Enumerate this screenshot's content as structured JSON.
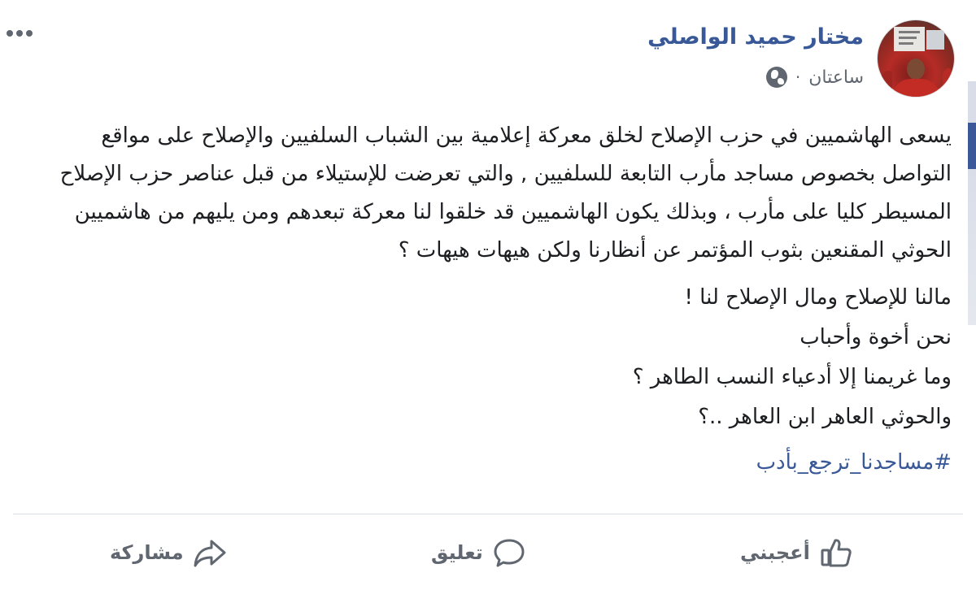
{
  "post": {
    "author": "مختار حميد الواصلي",
    "timestamp": "ساعتان",
    "separator": "·",
    "privacy_icon": "globe-icon",
    "menu_icon": "more-options-icon",
    "paragraph_1": "يسعى الهاشميين في حزب الإصلاح لخلق معركة إعلامية بين الشباب السلفيين والإصلاح على مواقع التواصل بخصوص مساجد مأرب التابعة للسلفيين , والتي تعرضت للإستيلاء من قبل عناصر حزب الإصلاح المسيطر كليا على مأرب ، وبذلك يكون الهاشميين قد خلقوا لنا معركة تبعدهم ومن يليهم من هاشميين الحوثي المقنعين بثوب المؤتمر عن أنظارنا ولكن هيهات هيهات ؟",
    "lines": [
      "مالنا للإصلاح ومال الإصلاح لنا !",
      "نحن أخوة وأحباب",
      "وما غريمنا إلا أدعياء النسب الطاهر ؟",
      "والحوثي العاهر ابن العاهر ..؟"
    ],
    "hashtag": "#مساجدنا_ترجع_بأدب"
  },
  "actions": {
    "like": "أعجبني",
    "comment": "تعليق",
    "share": "مشاركة"
  },
  "colors": {
    "link": "#385898",
    "text": "#1c1e21",
    "muted": "#606770",
    "divider": "#dadde1"
  }
}
